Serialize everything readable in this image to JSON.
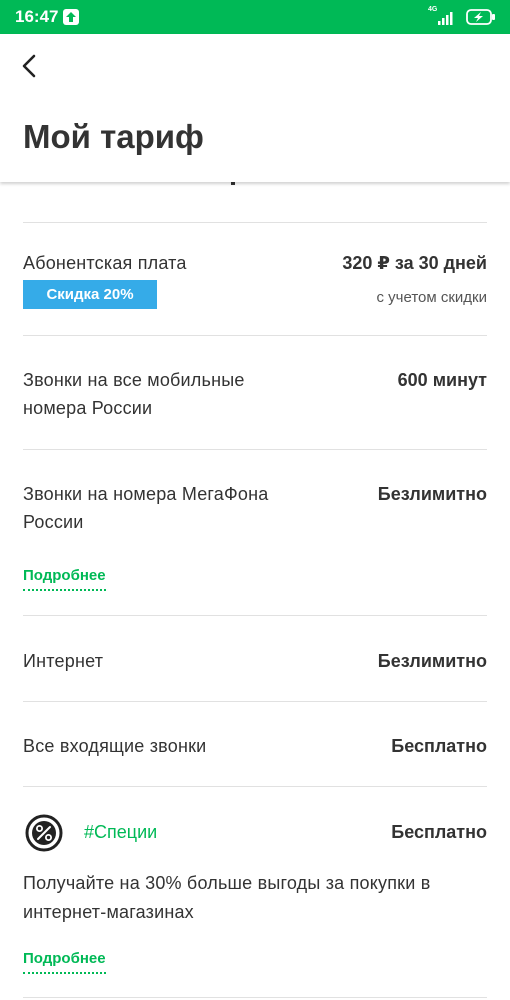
{
  "status_bar": {
    "time": "16:47",
    "network": "4G"
  },
  "header": {
    "title": "Мой тариф"
  },
  "rows": [
    {
      "label": "Абонентская плата",
      "value": "320 ₽ за 30 дней",
      "badge": "Скидка 20%",
      "note": "с учетом скидки"
    },
    {
      "label": "Звонки на все мобильные номера России",
      "value": "600 минут"
    },
    {
      "label": "Звонки на номера МегаФона России",
      "value": "Безлимитно",
      "more": "Подробнее"
    },
    {
      "label": "Интернет",
      "value": "Безлимитно"
    },
    {
      "label": "Все входящие звонки",
      "value": "Бесплатно"
    }
  ],
  "special": {
    "title": "#Специи",
    "value": "Бесплатно",
    "description": "Получайте на 30% больше выгоды за покупки в интернет-магазинах",
    "more": "Подробнее",
    "icon": "percent-badge-icon"
  },
  "colors": {
    "brand_green": "#00b956",
    "badge_blue": "#35abe8",
    "text": "#333333"
  }
}
